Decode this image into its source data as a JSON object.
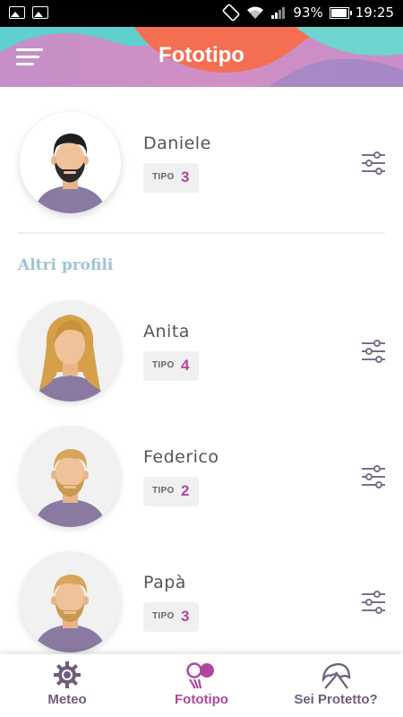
{
  "status_bar": {
    "battery": "93%",
    "time": "19:25",
    "icons": [
      "image-icon",
      "image-icon",
      "screen-rotation-icon",
      "wifi-icon",
      "signal-icon",
      "battery-icon"
    ]
  },
  "header": {
    "title": "Fototipo",
    "menu_icon": "hamburger-menu-icon"
  },
  "main_profile": {
    "name": "Daniele",
    "tipo_label": "TIPO",
    "tipo_value": "3",
    "avatar": "man-dark-hair-beard-avatar"
  },
  "other_profiles": {
    "title": "Altri profili",
    "items": [
      {
        "name": "Anita",
        "tipo_label": "TIPO",
        "tipo_value": "4",
        "avatar": "woman-blonde-avatar"
      },
      {
        "name": "Federico",
        "tipo_label": "TIPO",
        "tipo_value": "2",
        "avatar": "man-blond-beard-avatar"
      },
      {
        "name": "Papà",
        "tipo_label": "TIPO",
        "tipo_value": "3",
        "avatar": "man-blond-beard-avatar"
      }
    ]
  },
  "bottom_nav": {
    "items": [
      {
        "label": "Meteo",
        "icon": "sun-gear-icon",
        "active": false
      },
      {
        "label": "Fototipo",
        "icon": "fototipo-icon",
        "active": true
      },
      {
        "label": "Sei Protetto?",
        "icon": "umbrella-icon",
        "active": false
      }
    ]
  },
  "colors": {
    "accent": "#b0479a",
    "nav_inactive": "#6e5d7a",
    "section_title": "#9ec3d4",
    "header_purple": "#c58fc8",
    "header_teal": "#6fd4d0",
    "header_orange": "#f46f52"
  }
}
